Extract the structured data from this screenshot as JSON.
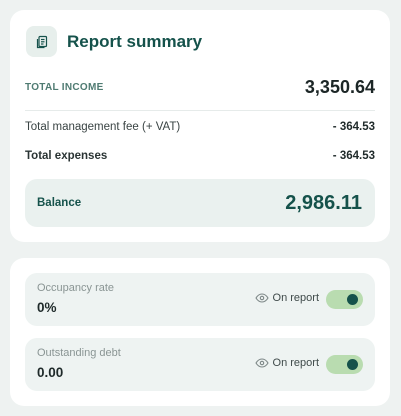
{
  "summary": {
    "title": "Report summary",
    "icon": "document-stack-icon",
    "total_income_label": "TOTAL INCOME",
    "total_income_value": "3,350.64",
    "fee_label": "Total management fee (+ VAT)",
    "fee_value": "- 364.53",
    "expenses_label": "Total expenses",
    "expenses_value": "- 364.53",
    "balance_label": "Balance",
    "balance_value": "2,986.11"
  },
  "settings": [
    {
      "label": "Occupancy rate",
      "value": "0%",
      "report_label": "On report",
      "enabled": true
    },
    {
      "label": "Outstanding debt",
      "value": "0.00",
      "report_label": "On report",
      "enabled": true
    }
  ],
  "colors": {
    "accent": "#15524b",
    "toggle_track": "#b9dcb0",
    "panel": "#eef3f2"
  }
}
